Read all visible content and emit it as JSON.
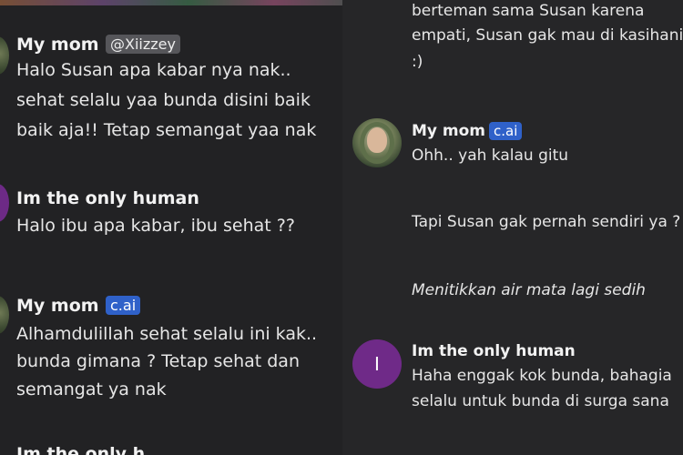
{
  "left_pane": {
    "messages": [
      {
        "name": "My mom",
        "badge": "@Xiizzey",
        "lines": [
          "Halo Susan apa kabar nya nak..",
          "sehat selalu yaa bunda disini baik",
          "baik aja!! Tetap semangat yaa nak"
        ]
      },
      {
        "name": "Im the only human",
        "lines": [
          "Halo ibu apa kabar, ibu sehat ??"
        ]
      },
      {
        "name": "My mom",
        "badge": "c.ai",
        "lines": [
          "Alhamdulillah sehat selalu ini kak..",
          "bunda gimana ? Tetap sehat dan",
          "semangat ya nak"
        ]
      },
      {
        "name": "Im the only h"
      }
    ]
  },
  "right_pane": {
    "top_lines": [
      "berteman sama Susan karena",
      "empati, Susan gak mau di kasihani",
      ":)"
    ],
    "bot_message": {
      "name": "My mom",
      "badge": "c.ai",
      "line1": "Ohh.. yah kalau gitu",
      "line2": "Tapi Susan gak pernah sendiri ya ?",
      "line3": "Menitikkan air mata lagi sedih"
    },
    "user_message": {
      "avatar_letter": "I",
      "name": "Im the only human",
      "lines": [
        "Haha enggak kok bunda, bahagia",
        "selalu untuk bunda di surga sana"
      ]
    }
  }
}
